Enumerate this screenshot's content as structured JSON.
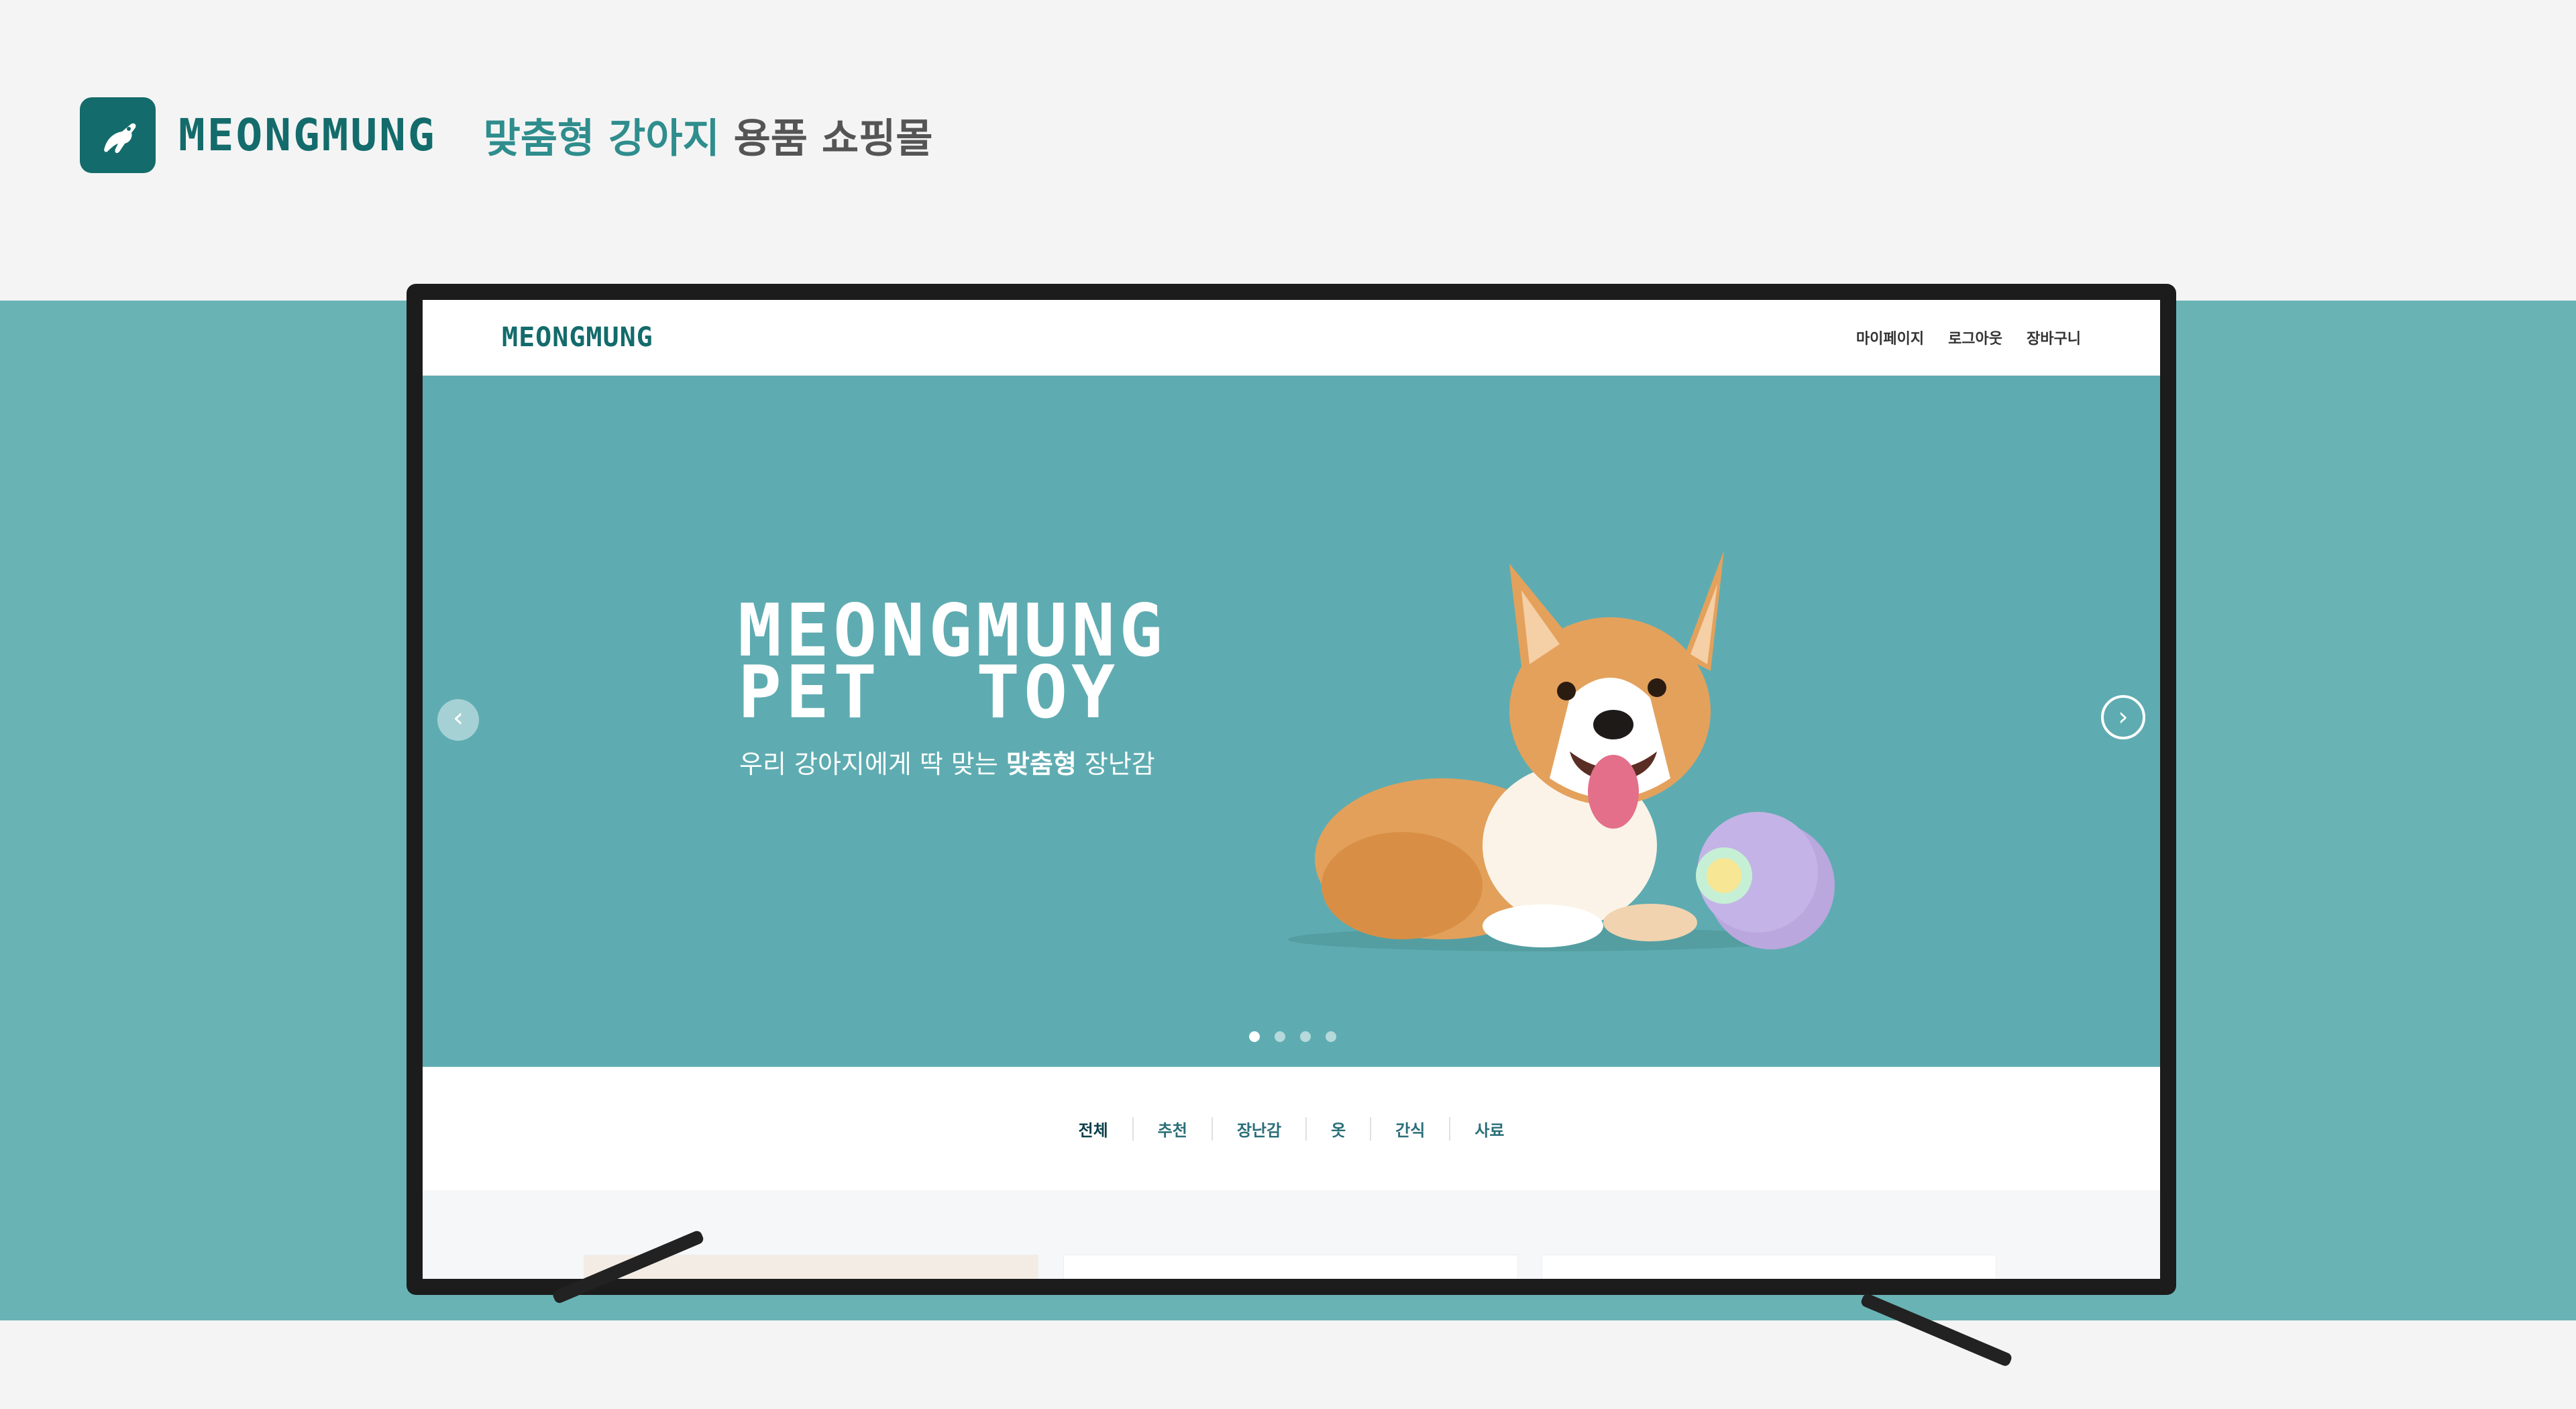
{
  "brand": {
    "name": "MEONGMUNG",
    "tagline_accent": "맞춤형 강아지",
    "tagline_rest": "용품 쇼핑몰",
    "color": "#146b6b"
  },
  "site": {
    "logo": "MEONGMUNG",
    "links": [
      "마이페이지",
      "로그아웃",
      "장바구니"
    ]
  },
  "hero": {
    "title_line1": "MEONGMUNG",
    "title_line2": "PET  TOY",
    "subtitle_pre": "우리 강아지에게 딱 맞는 ",
    "subtitle_bold": "맞춤형",
    "subtitle_post": " 장난감",
    "prev_icon": "chevron-left-icon",
    "next_icon": "chevron-right-icon",
    "slide_count": 4,
    "active_slide": 1,
    "background": "#5eacb1"
  },
  "categories": [
    "전체",
    "추천",
    "장난감",
    "옷",
    "간식",
    "사료"
  ],
  "active_category": "전체"
}
